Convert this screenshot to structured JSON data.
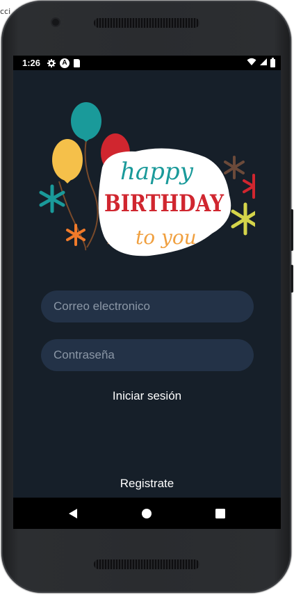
{
  "edge": {
    "text": "cci"
  },
  "status_bar": {
    "time": "1:26",
    "left_icons": [
      "gear-icon",
      "a-icon",
      "sd-card-icon"
    ],
    "right_icons": [
      "wifi-icon",
      "signal-icon",
      "battery-icon"
    ]
  },
  "illustration": {
    "line1": "happy",
    "line2": "BIRTHDAY",
    "line3": "to you"
  },
  "login": {
    "email_placeholder": "Correo electronico",
    "password_placeholder": "Contraseña",
    "login_label": "Iniciar sesión",
    "register_label": "Registrate"
  },
  "navigation": {
    "back": "back-icon",
    "home": "home-icon",
    "recents": "recents-icon"
  },
  "colors": {
    "screen_bg": "#161f29",
    "field_bg": "#233247",
    "placeholder": "#8b97a6",
    "text": "#ffffff"
  }
}
